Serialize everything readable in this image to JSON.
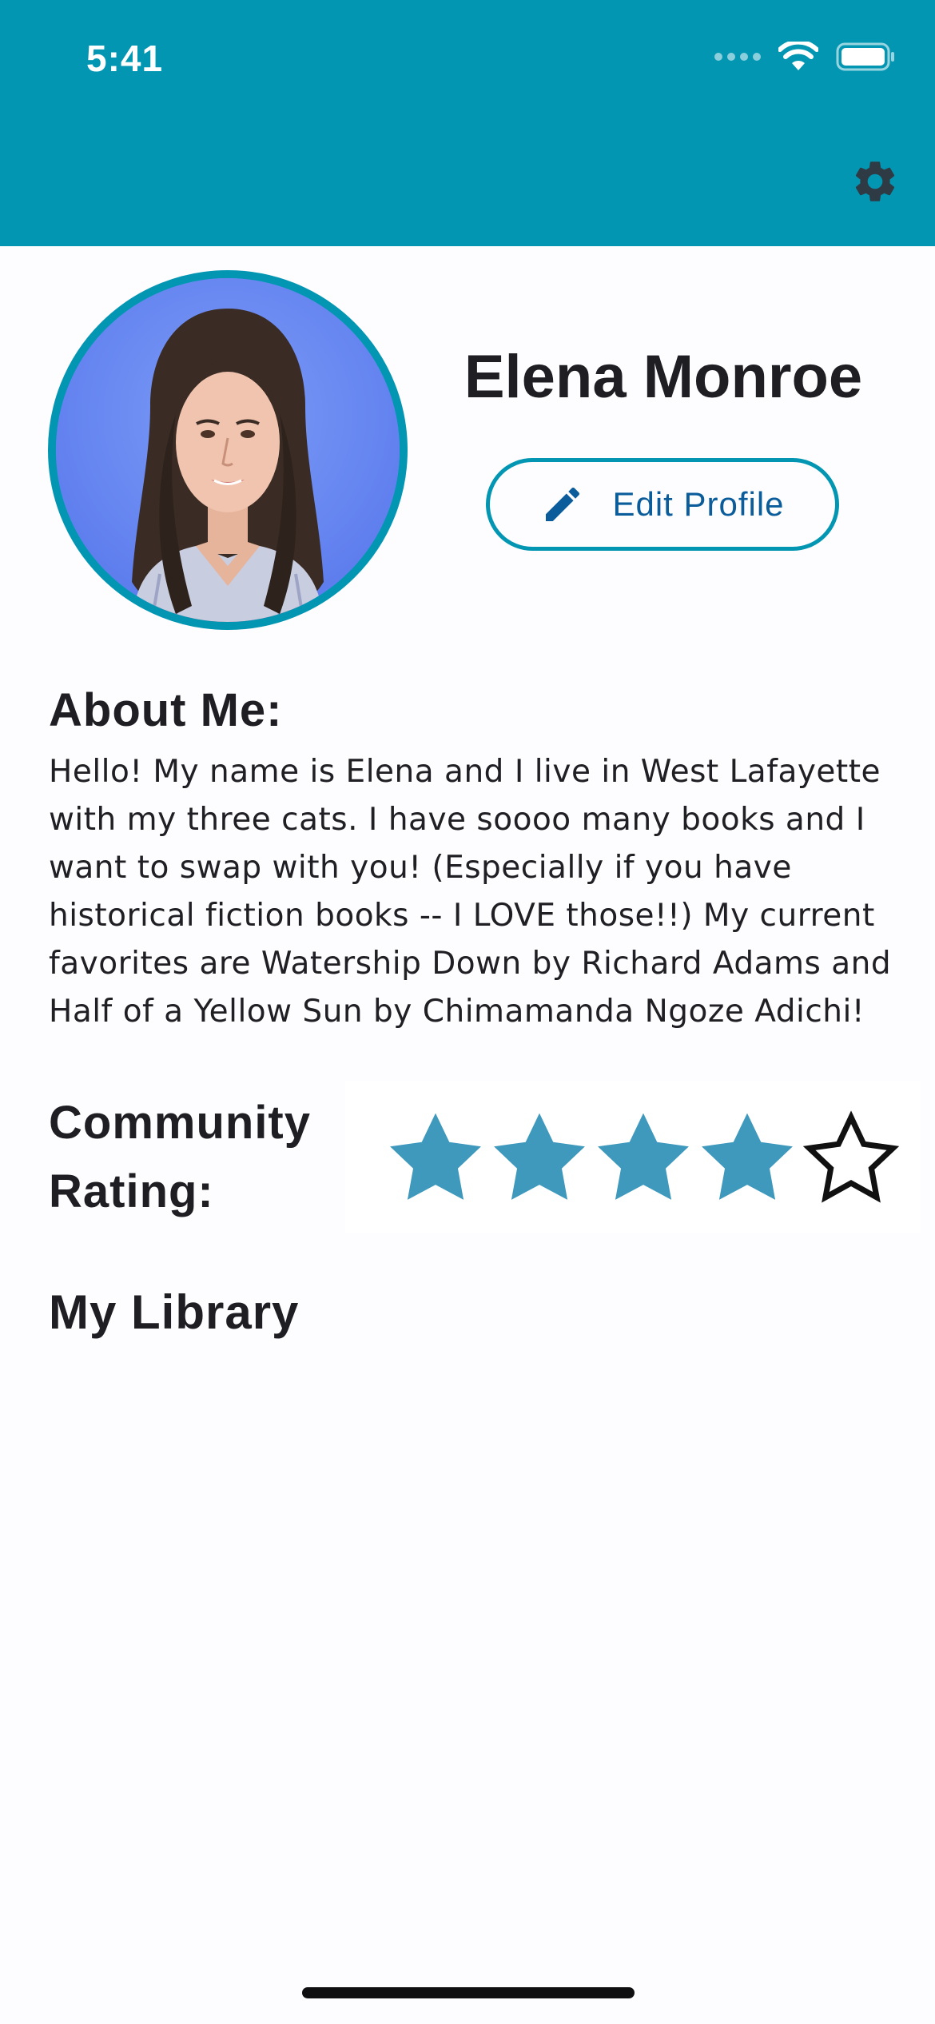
{
  "status_bar": {
    "time": "5:41"
  },
  "header": {
    "settings_icon": "gear-icon",
    "color": "#0296b2"
  },
  "profile": {
    "name": "Elena Monroe",
    "edit_button_label": "Edit Profile",
    "edit_icon": "pencil-icon",
    "avatar": "profile-photo"
  },
  "about": {
    "heading": "About Me:",
    "text": "Hello! My name is Elena and I live in West Lafayette with my three cats. I have soooo many books and I want to swap with you! (Especially if you have historical fiction books -- I LOVE those!!) My current favorites are Watership Down by Richard Adams and Half of a Yellow Sun by Chimamanda Ngoze Adichi!"
  },
  "rating": {
    "heading": "Community Rating:",
    "stars_filled": 4,
    "stars_total": 5,
    "star_color": "#3e99bd"
  },
  "library": {
    "heading": "My Library"
  }
}
